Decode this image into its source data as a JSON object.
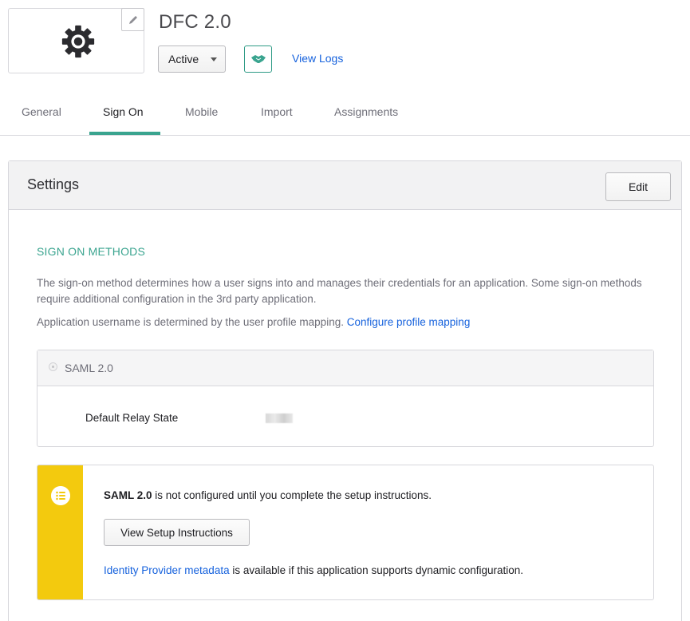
{
  "app": {
    "title": "DFC 2.0",
    "status_value": "Active",
    "view_logs_label": "View Logs",
    "logo_icon": "gear-icon",
    "edit_logo_icon": "pencil-icon",
    "push_icon": "handshake-icon"
  },
  "tabs": [
    {
      "label": "General",
      "active": false
    },
    {
      "label": "Sign On",
      "active": true
    },
    {
      "label": "Mobile",
      "active": false
    },
    {
      "label": "Import",
      "active": false
    },
    {
      "label": "Assignments",
      "active": false
    }
  ],
  "settings": {
    "title": "Settings",
    "edit_label": "Edit",
    "section_heading": "SIGN ON METHODS",
    "description": "The sign-on method determines how a user signs into and manages their credentials for an application. Some sign-on methods require additional configuration in the 3rd party application.",
    "mapping_text": "Application username is determined by the user profile mapping.",
    "mapping_link": "Configure profile mapping",
    "saml": {
      "option_label": "SAML 2.0",
      "relay_state_label": "Default Relay State"
    },
    "notice": {
      "icon": "list-icon",
      "bold_text": "SAML 2.0",
      "text": " is not configured until you complete the setup instructions.",
      "button_label": "View Setup Instructions",
      "metadata_link": "Identity Provider metadata",
      "metadata_text": " is available if this application supports dynamic configuration."
    }
  },
  "colors": {
    "accent": "#3aa48f",
    "link": "#1662dd",
    "notice_bar": "#f3ca0e"
  }
}
